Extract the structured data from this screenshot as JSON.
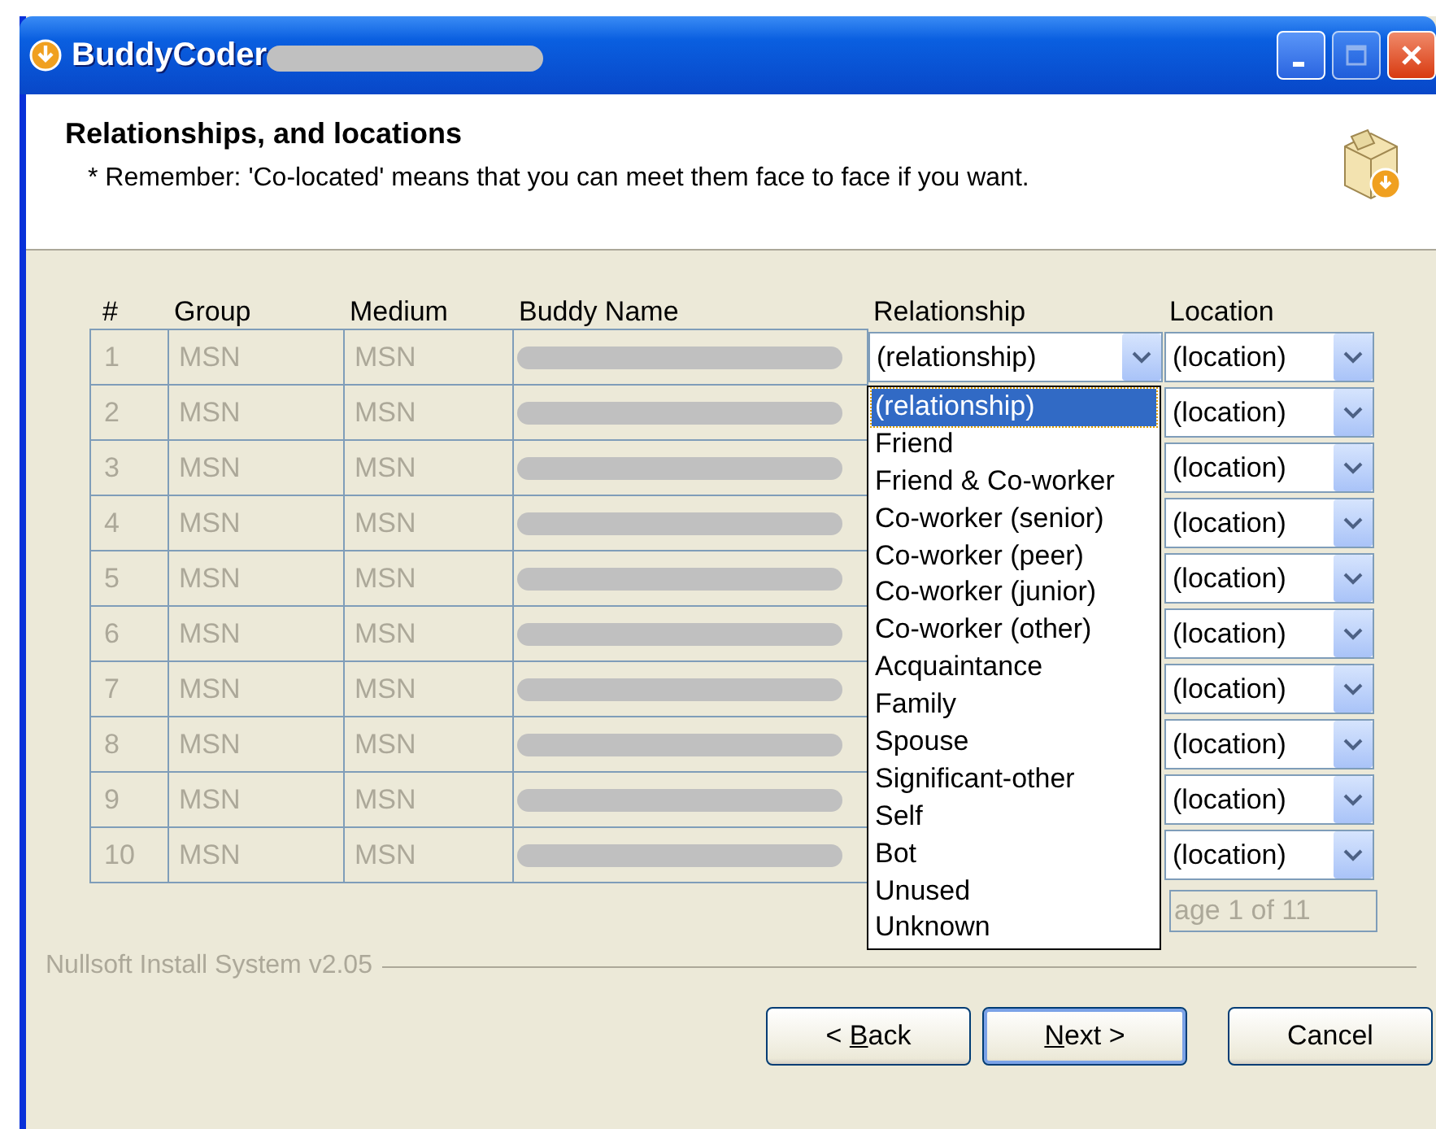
{
  "window": {
    "title": "BuddyCoder"
  },
  "header": {
    "title": "Relationships, and locations",
    "note": "* Remember: 'Co-located' means that you can meet them face to face if you want."
  },
  "table": {
    "columns": [
      "#",
      "Group",
      "Medium",
      "Buddy Name",
      "Relationship",
      "Location"
    ],
    "rows": [
      {
        "num": "1",
        "group": "MSN",
        "medium": "MSN",
        "relationship": "(relationship)",
        "location": "(location)"
      },
      {
        "num": "2",
        "group": "MSN",
        "medium": "MSN",
        "location": "(location)"
      },
      {
        "num": "3",
        "group": "MSN",
        "medium": "MSN",
        "location": "(location)"
      },
      {
        "num": "4",
        "group": "MSN",
        "medium": "MSN",
        "location": "(location)"
      },
      {
        "num": "5",
        "group": "MSN",
        "medium": "MSN",
        "location": "(location)"
      },
      {
        "num": "6",
        "group": "MSN",
        "medium": "MSN",
        "location": "(location)"
      },
      {
        "num": "7",
        "group": "MSN",
        "medium": "MSN",
        "location": "(location)"
      },
      {
        "num": "8",
        "group": "MSN",
        "medium": "MSN",
        "location": "(location)"
      },
      {
        "num": "9",
        "group": "MSN",
        "medium": "MSN",
        "location": "(location)"
      },
      {
        "num": "10",
        "group": "MSN",
        "medium": "MSN",
        "location": "(location)"
      }
    ]
  },
  "page_indicator": "age 1 of 11",
  "dropdown": {
    "options": [
      {
        "label": "(relationship)",
        "selected": true
      },
      {
        "label": "Friend",
        "selected": false
      },
      {
        "label": "Friend & Co-worker",
        "selected": false
      },
      {
        "label": "Co-worker (senior)",
        "selected": false
      },
      {
        "label": "Co-worker (peer)",
        "selected": false
      },
      {
        "label": "Co-worker (junior)",
        "selected": false
      },
      {
        "label": "Co-worker (other)",
        "selected": false
      },
      {
        "label": "Acquaintance",
        "selected": false
      },
      {
        "label": "Family",
        "selected": false
      },
      {
        "label": "Spouse",
        "selected": false
      },
      {
        "label": "Significant-other",
        "selected": false
      },
      {
        "label": "Self",
        "selected": false
      },
      {
        "label": "Bot",
        "selected": false
      },
      {
        "label": "Unused",
        "selected": false
      },
      {
        "label": "Unknown",
        "selected": false
      }
    ]
  },
  "branding": "Nullsoft Install System v2.05",
  "buttons": [
    {
      "label_before": "< ",
      "access_key": "B",
      "label_after": "ack",
      "default": false
    },
    {
      "access_key": "N",
      "label_after": "ext >",
      "default": true
    },
    {
      "label_before": "Cancel",
      "default": false
    }
  ]
}
